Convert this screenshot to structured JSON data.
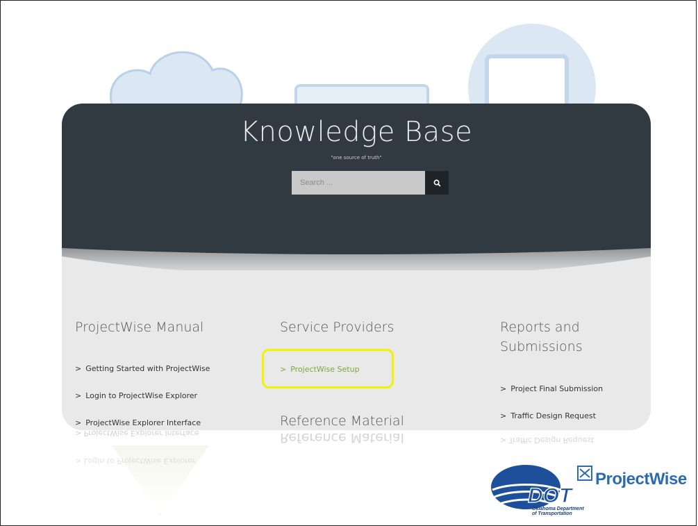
{
  "header": {
    "title": "Knowledge Base",
    "tagline": "\"one source of truth\"",
    "search_placeholder": "Search ...",
    "search_icon": "search-icon"
  },
  "columns": [
    {
      "title": "ProjectWise Manual",
      "links": [
        "Getting Started with ProjectWise",
        "Login to ProjectWise Explorer",
        "ProjectWise Explorer Interface"
      ]
    },
    {
      "title": "Service Providers",
      "links": [
        "ProjectWise Setup"
      ],
      "second_title": "Reference Material"
    },
    {
      "title_line1": "Reports and",
      "title_line2": "Submissions",
      "links": [
        "Project Final Submission",
        "Traffic Design Request"
      ]
    }
  ],
  "arrow": ">",
  "logo": {
    "dot": "DOT",
    "dot_sub_line1": "Oklahoma Department",
    "dot_sub_line2": "of Transportation",
    "product": "ProjectWise"
  },
  "colors": {
    "dark_panel": "#323a41",
    "light_panel": "#e9e9e9",
    "highlight": "#f3f300",
    "active_link": "#7fa83a",
    "brand_blue": "#2b6cb0"
  }
}
